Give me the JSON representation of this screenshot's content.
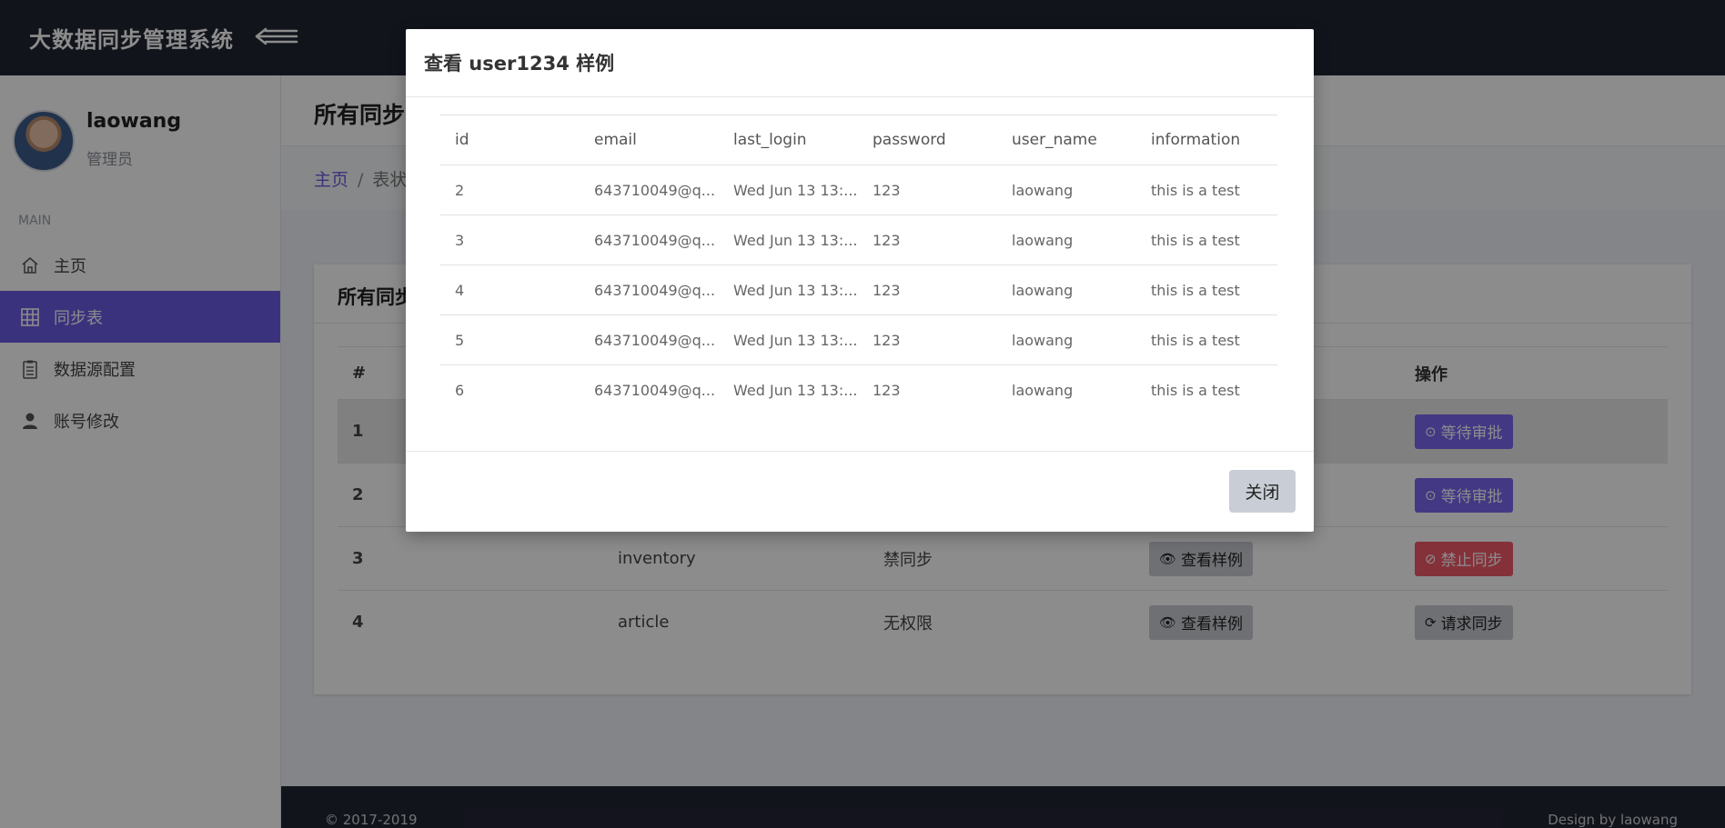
{
  "app": {
    "title": "大数据同步管理系统"
  },
  "user": {
    "name": "laowang",
    "role": "管理员"
  },
  "sidebar": {
    "section": "MAIN",
    "items": [
      {
        "label": "主页",
        "icon": "home-icon",
        "active": false
      },
      {
        "label": "同步表",
        "icon": "grid-icon",
        "active": true
      },
      {
        "label": "数据源配置",
        "icon": "clipboard-icon",
        "active": false
      },
      {
        "label": "账号修改",
        "icon": "user-icon",
        "active": false
      }
    ]
  },
  "page": {
    "title": "所有同步",
    "breadcrumb": {
      "home": "主页",
      "current": "表状"
    }
  },
  "card": {
    "title": "所有同步",
    "columns": {
      "num": "#",
      "actions": "操作"
    },
    "rows": [
      {
        "num": "1",
        "name": "",
        "status": "",
        "action": "等待审批",
        "action_style": "purple",
        "action_icon": "clock-icon"
      },
      {
        "num": "2",
        "name": "",
        "status": "",
        "action": "等待审批",
        "action_style": "purple",
        "action_icon": "clock-icon"
      },
      {
        "num": "3",
        "name": "inventory",
        "status": "禁同步",
        "view": "查看样例",
        "action": "禁止同步",
        "action_style": "red",
        "action_icon": "ban-icon"
      },
      {
        "num": "4",
        "name": "article",
        "status": "无权限",
        "view": "查看样例",
        "action": "请求同步",
        "action_style": "gray",
        "action_icon": "refresh-icon"
      }
    ]
  },
  "footer": {
    "copyright": "© 2017-2019",
    "design": "Design by laowang"
  },
  "modal": {
    "title": "查看 user1234 样例",
    "columns": [
      "id",
      "email",
      "last_login",
      "password",
      "user_name",
      "information"
    ],
    "rows": [
      [
        "2",
        "643710049@q...",
        "Wed Jun 13 13:...",
        "123",
        "laowang",
        "this is a test"
      ],
      [
        "3",
        "643710049@q...",
        "Wed Jun 13 13:...",
        "123",
        "laowang",
        "this is a test"
      ],
      [
        "4",
        "643710049@q...",
        "Wed Jun 13 13:...",
        "123",
        "laowang",
        "this is a test"
      ],
      [
        "5",
        "643710049@q...",
        "Wed Jun 13 13:...",
        "123",
        "laowang",
        "this is a test"
      ],
      [
        "6",
        "643710049@q...",
        "Wed Jun 13 13:...",
        "123",
        "laowang",
        "this is a test"
      ]
    ],
    "close_label": "关闭"
  },
  "colors": {
    "accent": "#6c5be3",
    "topbar": "#222534",
    "danger": "#f05a6a"
  }
}
